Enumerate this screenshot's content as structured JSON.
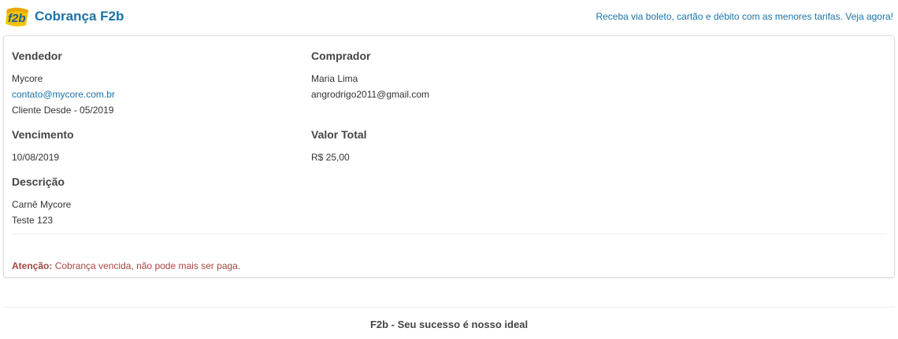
{
  "header": {
    "logo_icon": "f2b-logo-icon",
    "title": "Cobrança F2b",
    "promo_link": "Receba via boleto, cartão e débito com as menores tarifas. Veja agora!",
    "brand_color": "#1a73a8"
  },
  "billing": {
    "seller": {
      "label": "Vendedor",
      "name": "Mycore",
      "email": "contato@mycore.com.br",
      "since": "Cliente Desde - 05/2019"
    },
    "buyer": {
      "label": "Comprador",
      "name": "Maria Lima",
      "email": "angrodrigo2011@gmail.com"
    },
    "due": {
      "label": "Vencimento",
      "date": "10/08/2019"
    },
    "total": {
      "label": "Valor Total",
      "amount": "R$ 25,00"
    },
    "description": {
      "label": "Descrição",
      "line1": "Carnê Mycore",
      "line2": "Teste 123"
    }
  },
  "warning": {
    "prefix": "Atenção:",
    "message": "Cobrança vencida, não pode mais ser paga.",
    "color": "#a94442"
  },
  "footer": {
    "text": "F2b - Seu sucesso é nosso ideal"
  }
}
